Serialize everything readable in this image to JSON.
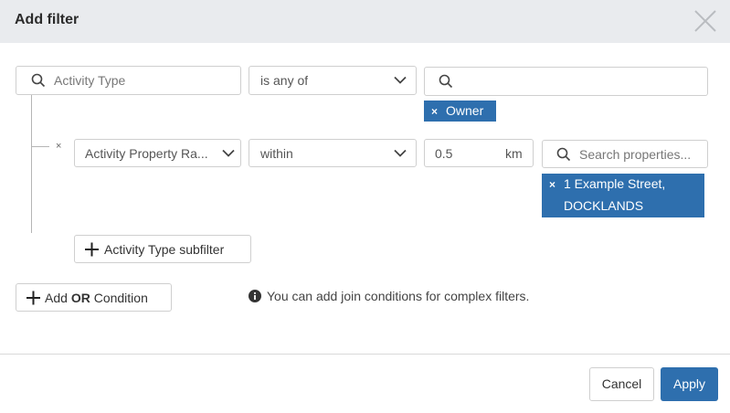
{
  "dialog": {
    "title": "Add filter"
  },
  "filter_row": {
    "field_placeholder": "Activity Type",
    "operator": "is any of",
    "values": [
      "Owner"
    ]
  },
  "subfilter_row": {
    "field": "Activity Property Ra...",
    "operator": "within",
    "distance": "0.5",
    "unit": "km",
    "search_placeholder": "Search properties...",
    "selected_property_line1": "1 Example Street,",
    "selected_property_line2": "DOCKLANDS",
    "remove_symbol": "×"
  },
  "actions": {
    "add_subfilter_label": "Activity Type subfilter",
    "add_or_prefix": "Add",
    "add_or_bold": "OR",
    "add_or_suffix": "Condition",
    "info_text": "You can add join conditions for complex filters."
  },
  "footer": {
    "cancel_label": "Cancel",
    "apply_label": "Apply"
  },
  "colors": {
    "accent": "#2e6fae",
    "header_bg": "#e9ebee"
  }
}
